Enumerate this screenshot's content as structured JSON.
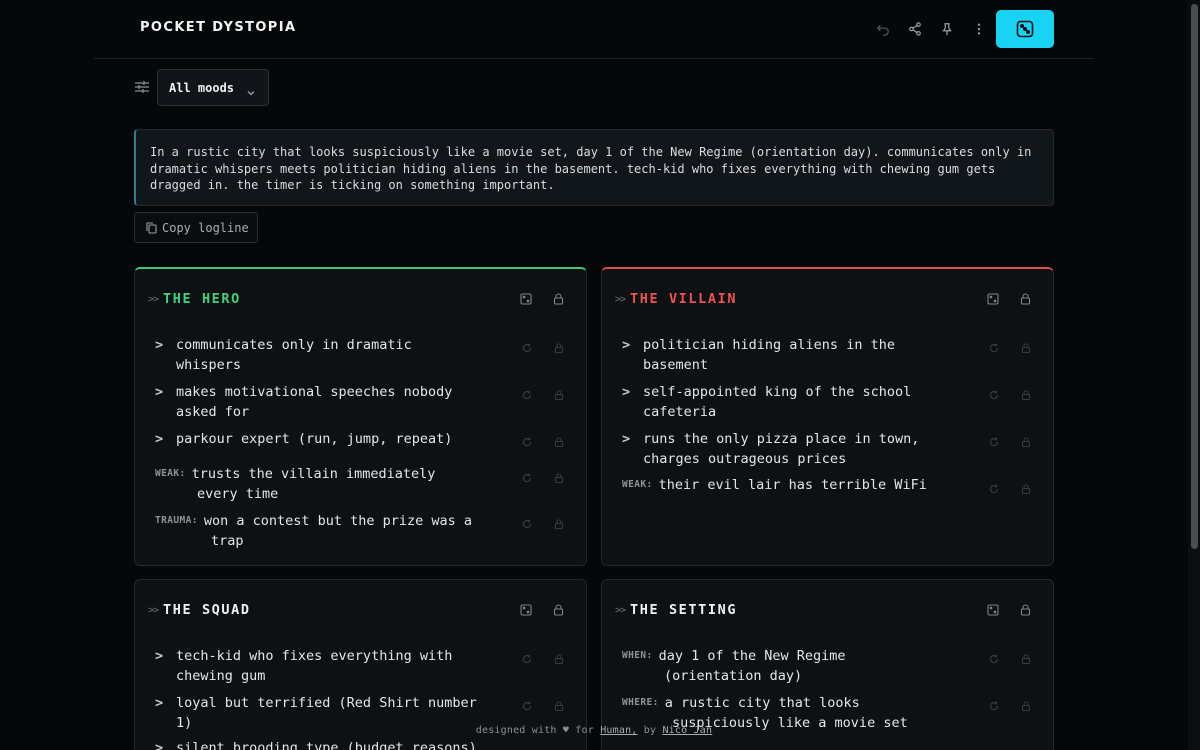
{
  "app": {
    "title": "POCKET DYSTOPIA"
  },
  "toolbar": {
    "icons": [
      "undo-icon",
      "share-icon",
      "pin-icon",
      "more-vertical-icon",
      "dice-icon"
    ],
    "accent": "#19d3f2"
  },
  "filter": {
    "mood_label": "All moods"
  },
  "logline": {
    "text": "In a rustic city that looks suspiciously like a movie set, day 1 of the New Regime (orientation day). communicates only in dramatic whispers meets politician hiding aliens in the basement. tech-kid who fixes everything with chewing gum gets dragged in. the timer is ticking on something important.",
    "copy_label": "Copy logline"
  },
  "cards": {
    "hero": {
      "prefix": ">>",
      "title": "THE HERO",
      "color": "#44d17f",
      "traits": [
        {
          "line1": "communicates only in dramatic",
          "line2": "whispers"
        },
        {
          "line1": "makes motivational speeches nobody",
          "line2": "asked for"
        },
        {
          "line1": "parkour expert (run, jump, repeat)",
          "line2": ""
        }
      ],
      "weak": {
        "tag": "WEAK:",
        "line1": "trusts the villain immediately",
        "line2": "every time"
      },
      "trauma": {
        "tag": "TRAUMA:",
        "line1": "won a contest but the prize was a",
        "line2": "trap"
      }
    },
    "villain": {
      "prefix": ">>",
      "title": "THE VILLAIN",
      "color": "#ef5151",
      "traits": [
        {
          "line1": "politician hiding aliens in the",
          "line2": "basement"
        },
        {
          "line1": "self-appointed king of the school",
          "line2": "cafeteria"
        },
        {
          "line1": "runs the only pizza place in town,",
          "line2": "charges outrageous prices"
        }
      ],
      "weak": {
        "tag": "WEAK:",
        "line1": "their evil lair has terrible WiFi",
        "line2": ""
      }
    },
    "squad": {
      "prefix": ">>",
      "title": "THE SQUAD",
      "traits": [
        {
          "line1": "tech-kid who fixes everything with",
          "line2": "chewing gum"
        },
        {
          "line1": "loyal but terrified (Red Shirt number",
          "line2": "1)"
        },
        {
          "line1": "silent brooding type (budget reasons)",
          "line2": ""
        }
      ]
    },
    "setting": {
      "prefix": ">>",
      "title": "THE SETTING",
      "when": {
        "tag": "WHEN:",
        "line1": "day 1 of the New Regime",
        "line2": "(orientation day)"
      },
      "where": {
        "tag": "WHERE:",
        "line1": "a rustic city that looks",
        "line2": "suspiciously like a movie set"
      }
    }
  },
  "footer": {
    "prefix": "designed with ♥ for",
    "link1": "Human,",
    "by": "by",
    "link2": "Nico Jan"
  }
}
